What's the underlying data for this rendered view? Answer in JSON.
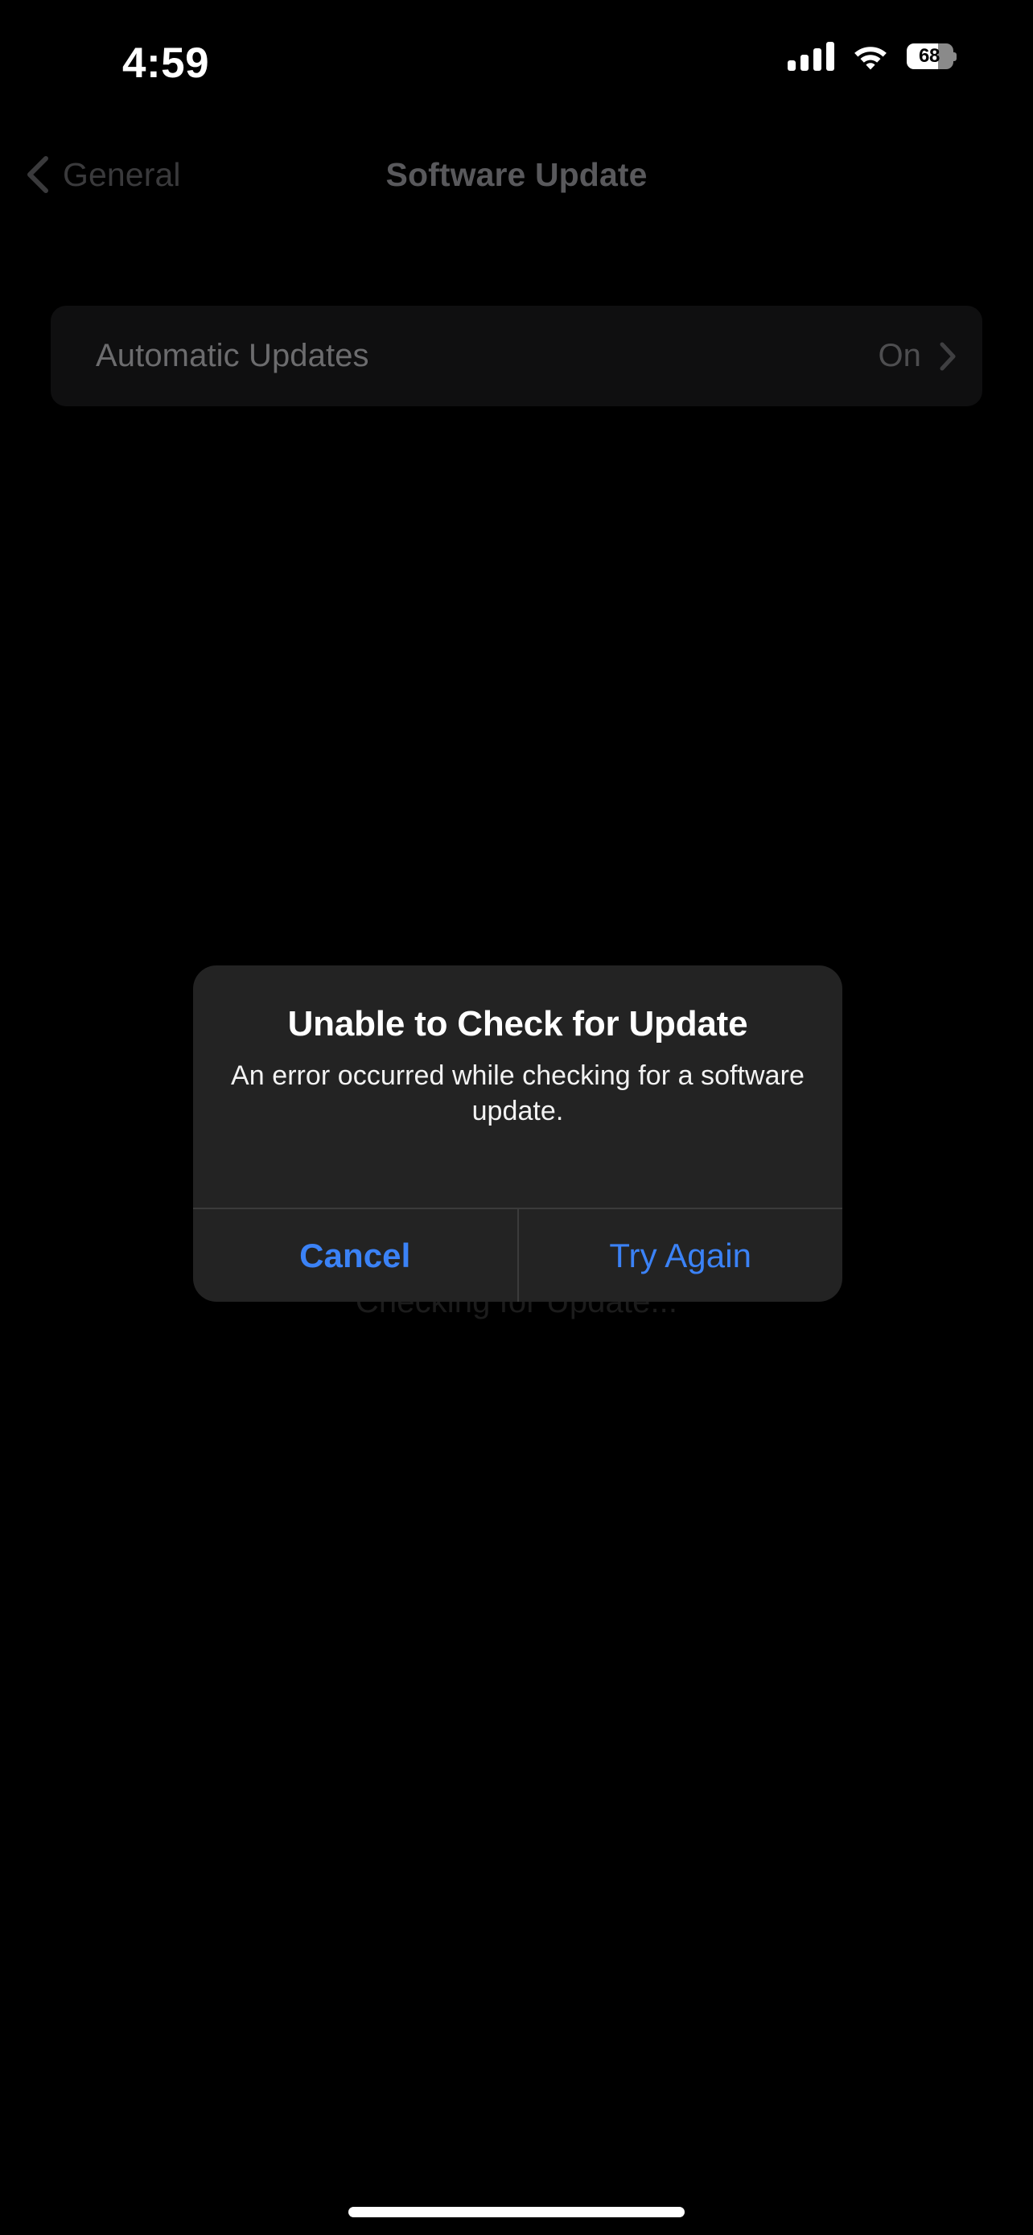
{
  "status_bar": {
    "time": "4:59",
    "cellular_icon": "cellular-bars-icon",
    "cellular_bars_filled": 4,
    "cellular_bars_total": 4,
    "wifi_icon": "wifi-icon",
    "battery_icon": "battery-icon",
    "battery_percent": "68",
    "battery_level": 68
  },
  "nav_bar": {
    "back_icon": "chevron-left-icon",
    "back_label": "General",
    "title": "Software Update"
  },
  "settings": {
    "rows": [
      {
        "label": "Automatic Updates",
        "value": "On",
        "chevron_icon": "chevron-right-icon"
      }
    ]
  },
  "background_status": {
    "text": "Checking for Update..."
  },
  "alert": {
    "title": "Unable to Check for Update",
    "message": "An error occurred while checking for a software update.",
    "buttons": [
      {
        "label": "Cancel",
        "role": "cancel"
      },
      {
        "label": "Try Again",
        "role": "default"
      }
    ]
  },
  "home_indicator": {
    "name": "home-indicator"
  },
  "colors": {
    "background": "#000000",
    "card": "#0f0f10",
    "alert_background": "#232323",
    "accent_blue": "#3b82f6",
    "dimmed_text": "#6c6c6e",
    "primary_text": "#ffffff"
  }
}
